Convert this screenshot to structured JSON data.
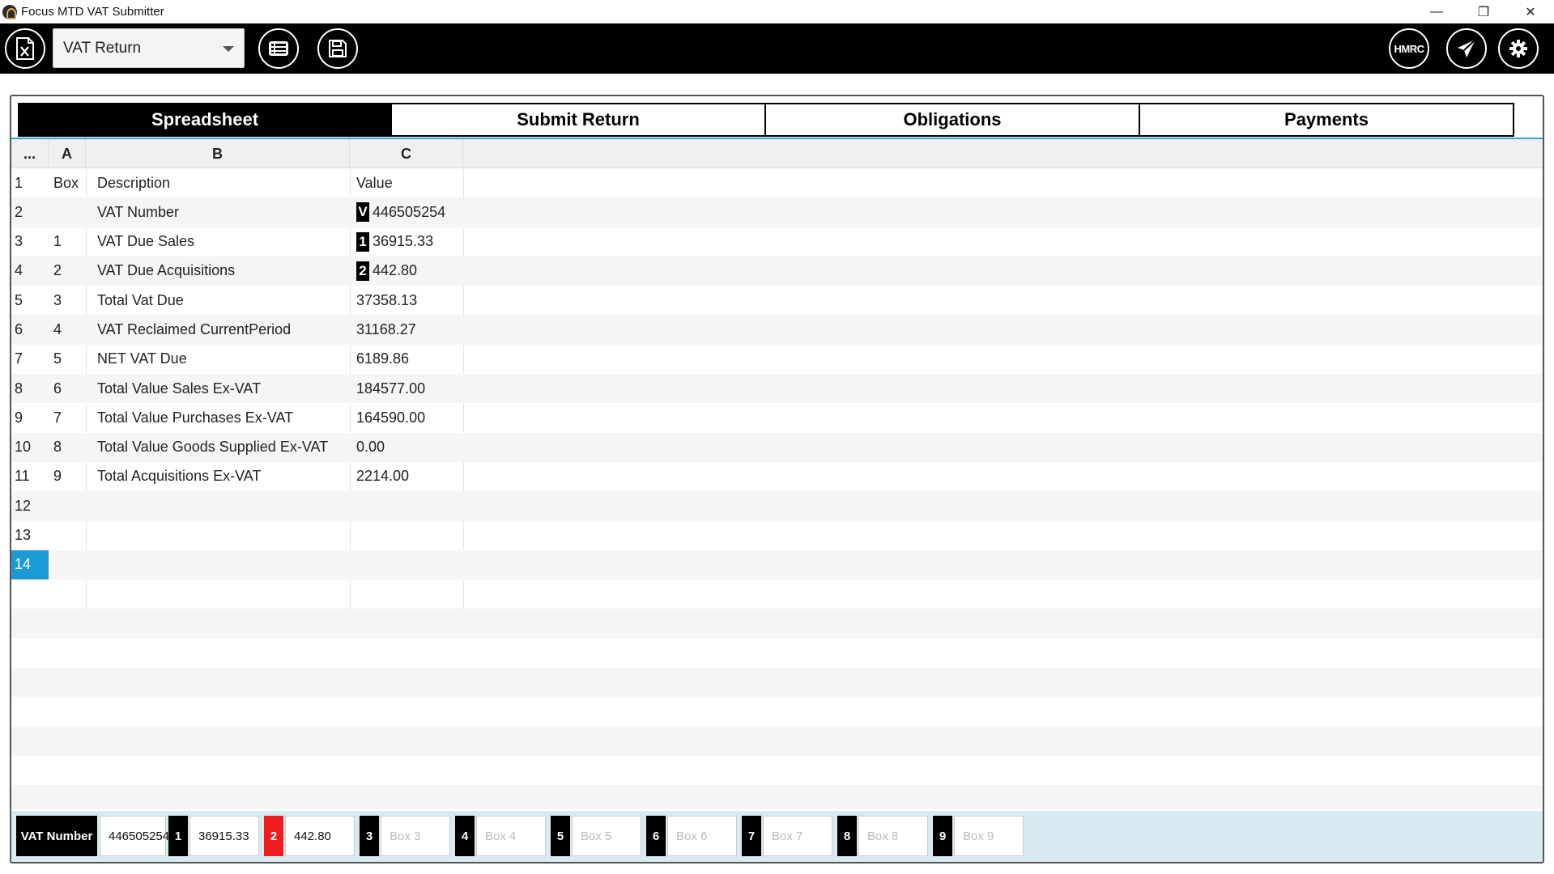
{
  "window": {
    "title": "Focus MTD VAT Submitter",
    "minimize": "—",
    "restore": "❐",
    "close": "✕"
  },
  "toolbar": {
    "document_type": "VAT Return",
    "hmrc_label": "HMRC"
  },
  "tabs": [
    {
      "label": "Spreadsheet",
      "active": true
    },
    {
      "label": "Submit Return",
      "active": false
    },
    {
      "label": "Obligations",
      "active": false
    },
    {
      "label": "Payments",
      "active": false
    }
  ],
  "sheet": {
    "columns": [
      "...",
      "A",
      "B",
      "C"
    ],
    "rows": [
      {
        "n": "1",
        "a": "Box",
        "b": "Description",
        "c": "Value",
        "badge": ""
      },
      {
        "n": "2",
        "a": "",
        "b": "VAT Number",
        "c": "446505254",
        "badge": "V"
      },
      {
        "n": "3",
        "a": "1",
        "b": "VAT Due Sales",
        "c": "36915.33",
        "badge": "1"
      },
      {
        "n": "4",
        "a": "2",
        "b": "VAT Due Acquisitions",
        "c": "442.80",
        "badge": "2"
      },
      {
        "n": "5",
        "a": "3",
        "b": "Total Vat Due",
        "c": "37358.13",
        "badge": ""
      },
      {
        "n": "6",
        "a": "4",
        "b": "VAT Reclaimed CurrentPeriod",
        "c": "31168.27",
        "badge": ""
      },
      {
        "n": "7",
        "a": "5",
        "b": "NET VAT Due",
        "c": "6189.86",
        "badge": ""
      },
      {
        "n": "8",
        "a": "6",
        "b": " Total Value Sales Ex-VAT",
        "c": "184577.00",
        "badge": ""
      },
      {
        "n": "9",
        "a": "7",
        "b": "Total Value Purchases Ex-VAT",
        "c": "164590.00",
        "badge": ""
      },
      {
        "n": "10",
        "a": "8",
        "b": "Total Value Goods Supplied Ex-VAT",
        "c": "0.00",
        "badge": ""
      },
      {
        "n": "11",
        "a": "9",
        "b": "Total Acquisitions Ex-VAT",
        "c": "2214.00",
        "badge": ""
      },
      {
        "n": "12",
        "a": "",
        "b": "",
        "c": "",
        "badge": ""
      },
      {
        "n": "13",
        "a": "",
        "b": "",
        "c": "",
        "badge": ""
      },
      {
        "n": "14",
        "a": "",
        "b": "",
        "c": "",
        "badge": "",
        "selected": true
      }
    ]
  },
  "boxbar": {
    "vat_label": "VAT Number",
    "vat_value": "446505254",
    "boxes": [
      {
        "num": "1",
        "value": "36915.33",
        "placeholder": ""
      },
      {
        "num": "2",
        "value": "442.80",
        "placeholder": ""
      },
      {
        "num": "3",
        "value": "",
        "placeholder": "Box 3"
      },
      {
        "num": "4",
        "value": "",
        "placeholder": "Box 4"
      },
      {
        "num": "5",
        "value": "",
        "placeholder": "Box 5"
      },
      {
        "num": "6",
        "value": "",
        "placeholder": "Box 6"
      },
      {
        "num": "7",
        "value": "",
        "placeholder": "Box 7"
      },
      {
        "num": "8",
        "value": "",
        "placeholder": "Box 8"
      },
      {
        "num": "9",
        "value": "",
        "placeholder": "Box 9"
      }
    ]
  }
}
